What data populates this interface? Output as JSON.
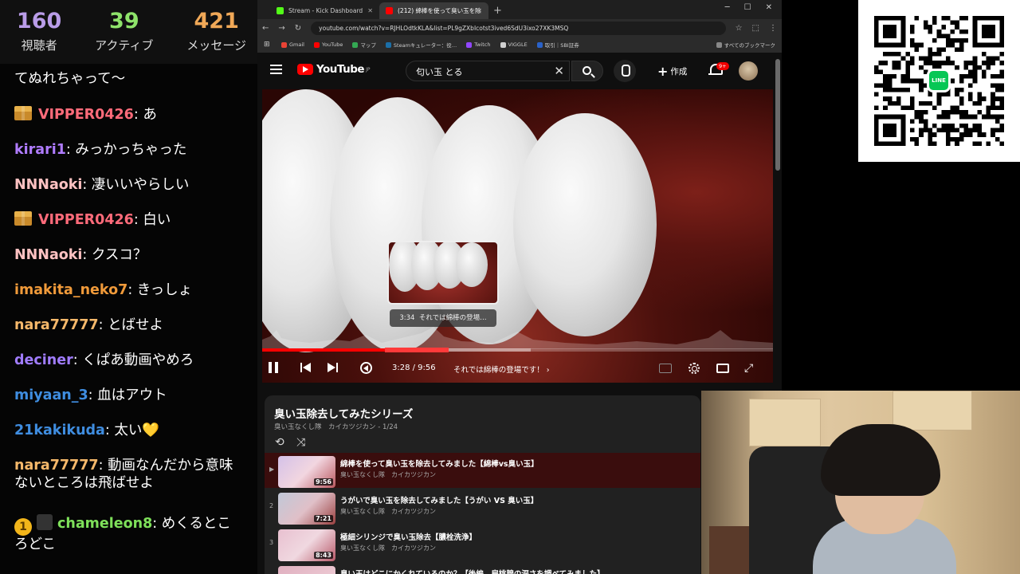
{
  "stats": [
    {
      "value": "160",
      "label": "視聴者",
      "color": "#b99ce8"
    },
    {
      "value": "39",
      "label": "アクティブ",
      "color": "#8ee36a"
    },
    {
      "value": "421",
      "label": "メッセージ",
      "color": "#f0a857"
    }
  ],
  "chat": [
    {
      "user": "",
      "text": "てぬれちゃって〜"
    },
    {
      "user": "VIPPER0426",
      "text": "あ",
      "color": "#ff6b7a"
    },
    {
      "user": "kirari1",
      "text": "みっかっちゃった",
      "color": "#b07cff"
    },
    {
      "user": "NNNaoki",
      "text": "凄いいやらしい",
      "color": "#ffc2c2"
    },
    {
      "user": "VIPPER0426",
      "text": "白い",
      "color": "#ff6b7a"
    },
    {
      "user": "NNNaoki",
      "text": "クスコ？",
      "color": "#ffc2c2"
    },
    {
      "user": "imakita_neko7",
      "text": "きっしょ",
      "color": "#f09a3a"
    },
    {
      "user": "nara77777",
      "text": "とばせよ",
      "color": "#f5b86a"
    },
    {
      "user": "deciner",
      "text": "くぱあ動画やめろ",
      "color": "#a07cff"
    },
    {
      "user": "miyaan_3",
      "text": "血はアウト",
      "color": "#3f8de0"
    },
    {
      "user": "21kakikuda",
      "text": "太い💛",
      "color": "#3f8de0"
    },
    {
      "user": "nara77777",
      "text": "動画なんだから意味",
      "text2": "ないところは飛ばせよ",
      "color": "#f5b86a"
    },
    {
      "user": "chameleon8",
      "text": "めくるとこ",
      "text2": "ろどこ",
      "color": "#7ee05a",
      "coin": "1"
    }
  ],
  "browser": {
    "tabs": [
      {
        "label": "Stream - Kick Dashboard",
        "color": "#53fc18"
      },
      {
        "label": "(212) 綿棒を使って臭い玉を除",
        "color": "#ff0000"
      }
    ],
    "new_tab": "+",
    "url": "youtube.com/watch?v=RJHLOdtkKLA&list=PL9gZXbIcotst3ived6SdU3ixo27XK3MSQ",
    "bookmarks": [
      {
        "label": "Gmail",
        "color": "#ea4335"
      },
      {
        "label": "YouTube",
        "color": "#ff0000"
      },
      {
        "label": "マップ",
        "color": "#34a853"
      },
      {
        "label": "Steamキュレーター：役…",
        "color": "#1b6fa8"
      },
      {
        "label": "Twitch",
        "color": "#9146ff"
      },
      {
        "label": "VIGGLE",
        "color": "#d0d0d0"
      },
      {
        "label": "取引｜SBI証券",
        "color": "#2a62c9"
      }
    ],
    "all_bookmarks": "すべてのブックマーク"
  },
  "youtube": {
    "logo": "YouTube",
    "region": "JP",
    "search_value": "匂い玉 とる",
    "create_label": "作成",
    "notif_badge": "9+"
  },
  "player": {
    "hover_time": "3:34",
    "hover_chapter": "それでは綿棒の登場…",
    "current_time": "3:28 / 9:56",
    "chapter": "それでは綿棒の登場です！ ›",
    "progress_fraction": 0.365
  },
  "playlist": {
    "title": "臭い玉除去してみたシリーズ",
    "subtitle": "臭い玉なくし隊　カイカツジカン - 1/24",
    "items": [
      {
        "index": "▶",
        "duration": "9:56",
        "title": "綿棒を使って臭い玉を除去してみました【綿棒vs臭い玉】",
        "channel": "臭い玉なくし隊　カイカツジカン"
      },
      {
        "index": "2",
        "duration": "7:21",
        "title": "うがいで臭い玉を除去してみました【うがい VS 臭い玉】",
        "channel": "臭い玉なくし隊　カイカツジカン"
      },
      {
        "index": "3",
        "duration": "8:43",
        "title": "極細シリンジで臭い玉除去【膿栓洗浄】",
        "channel": "臭い玉なくし隊　カイカツジカン"
      },
      {
        "index": "",
        "duration": "",
        "title": "臭い玉はどこにかくれているのか？【後編　扁桃腺の深さを調べてみました】",
        "channel": ""
      }
    ]
  },
  "overlay": {
    "line_label": "LINE"
  }
}
